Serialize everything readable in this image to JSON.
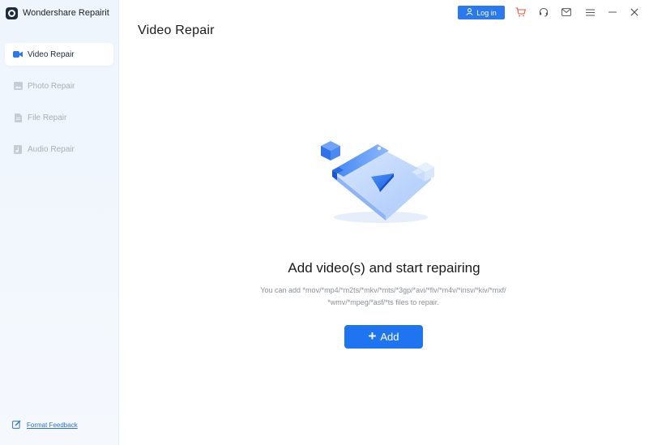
{
  "app": {
    "title": "Wondershare Repairit"
  },
  "sidebar": {
    "items": [
      {
        "label": "Video Repair",
        "icon": "video-icon",
        "active": true
      },
      {
        "label": "Photo Repair",
        "icon": "photo-icon",
        "active": false
      },
      {
        "label": "File Repair",
        "icon": "file-icon",
        "active": false
      },
      {
        "label": "Audio Repair",
        "icon": "audio-icon",
        "active": false
      }
    ],
    "feedback_label": "Format Feedback"
  },
  "topbar": {
    "login_label": "Log in",
    "icons": [
      "cart-icon",
      "headset-icon",
      "mail-icon",
      "menu-icon",
      "minimize-icon",
      "close-icon"
    ]
  },
  "main": {
    "title": "Video Repair",
    "heading": "Add video(s) and start repairing",
    "description_line1": "You can add *mov/*mp4/*m2ts/*mkv/*mts/*3gp/*avi/*flv/*m4v/*insv/*kiv/*mxf/",
    "description_line2": "*wmv/*mpeg/*asf/*ts files to repair.",
    "add_button_label": "Add"
  },
  "colors": {
    "accent": "#1f75f0",
    "sidebar_bg": "#eef5fd",
    "cart": "#e8523a",
    "link": "#2e6fdc"
  }
}
